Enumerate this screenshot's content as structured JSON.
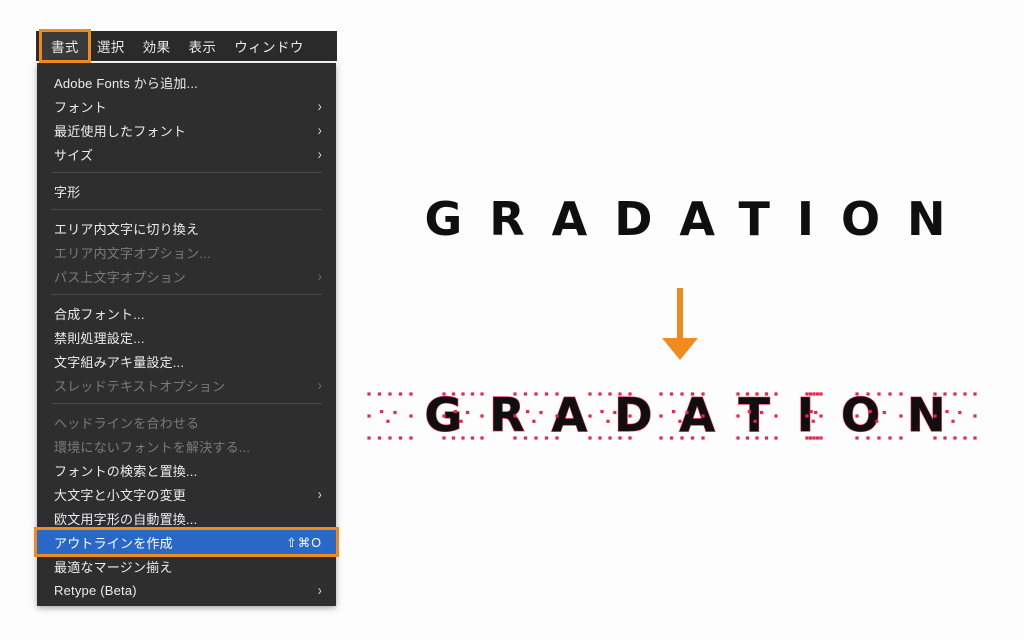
{
  "app": {
    "menubar": {
      "items": [
        {
          "label": "書式",
          "active": true
        },
        {
          "label": "選択",
          "active": false
        },
        {
          "label": "効果",
          "active": false
        },
        {
          "label": "表示",
          "active": false
        },
        {
          "label": "ウィンドウ",
          "active": false
        }
      ]
    },
    "dropdown": {
      "items": [
        {
          "label": "Adobe Fonts から追加...",
          "type": "item",
          "state": "enabled",
          "submenu": false,
          "shortcut": ""
        },
        {
          "label": "フォント",
          "type": "item",
          "state": "enabled",
          "submenu": true,
          "shortcut": ""
        },
        {
          "label": "最近使用したフォント",
          "type": "item",
          "state": "enabled",
          "submenu": true,
          "shortcut": ""
        },
        {
          "label": "サイズ",
          "type": "item",
          "state": "enabled",
          "submenu": true,
          "shortcut": ""
        },
        {
          "label": "",
          "type": "separator",
          "state": "",
          "submenu": false,
          "shortcut": ""
        },
        {
          "label": "字形",
          "type": "item",
          "state": "enabled",
          "submenu": false,
          "shortcut": ""
        },
        {
          "label": "",
          "type": "separator",
          "state": "",
          "submenu": false,
          "shortcut": ""
        },
        {
          "label": "エリア内文字に切り換え",
          "type": "item",
          "state": "enabled",
          "submenu": false,
          "shortcut": ""
        },
        {
          "label": "エリア内文字オプション...",
          "type": "item",
          "state": "disabled",
          "submenu": false,
          "shortcut": ""
        },
        {
          "label": "パス上文字オプション",
          "type": "item",
          "state": "disabled",
          "submenu": true,
          "shortcut": ""
        },
        {
          "label": "",
          "type": "separator",
          "state": "",
          "submenu": false,
          "shortcut": ""
        },
        {
          "label": "合成フォント...",
          "type": "item",
          "state": "enabled",
          "submenu": false,
          "shortcut": ""
        },
        {
          "label": "禁則処理設定...",
          "type": "item",
          "state": "enabled",
          "submenu": false,
          "shortcut": ""
        },
        {
          "label": "文字組みアキ量設定...",
          "type": "item",
          "state": "enabled",
          "submenu": false,
          "shortcut": ""
        },
        {
          "label": "スレッドテキストオプション",
          "type": "item",
          "state": "disabled",
          "submenu": true,
          "shortcut": ""
        },
        {
          "label": "",
          "type": "separator",
          "state": "",
          "submenu": false,
          "shortcut": ""
        },
        {
          "label": "ヘッドラインを合わせる",
          "type": "item",
          "state": "disabled",
          "submenu": false,
          "shortcut": ""
        },
        {
          "label": "環境にないフォントを解決する...",
          "type": "item",
          "state": "disabled",
          "submenu": false,
          "shortcut": ""
        },
        {
          "label": "フォントの検索と置換...",
          "type": "item",
          "state": "enabled",
          "submenu": false,
          "shortcut": ""
        },
        {
          "label": "大文字と小文字の変更",
          "type": "item",
          "state": "enabled",
          "submenu": true,
          "shortcut": ""
        },
        {
          "label": "欧文用字形の自動置換...",
          "type": "item",
          "state": "enabled",
          "submenu": false,
          "shortcut": ""
        },
        {
          "label": "アウトラインを作成",
          "type": "item",
          "state": "selected",
          "submenu": false,
          "shortcut": "⇧⌘O"
        },
        {
          "label": "最適なマージン揃え",
          "type": "item",
          "state": "enabled",
          "submenu": false,
          "shortcut": ""
        },
        {
          "label": "Retype (Beta)",
          "type": "item",
          "state": "enabled",
          "submenu": true,
          "shortcut": ""
        }
      ]
    },
    "artwork": {
      "text_before": "GRADATION",
      "text_after": "GRADATION",
      "arrow": "down-arrow"
    },
    "colors": {
      "menubar_bg": "#2a2a2a",
      "menu_bg": "#2e2e2e",
      "menu_text": "#ececec",
      "menu_text_disabled": "#7a7a7a",
      "selection_blue": "#2a68c8",
      "highlight_orange": "#f08a1b",
      "arrow_orange": "#ef8b21",
      "canvas_bg": "#fdfdfd",
      "artwork_black": "#100f0f",
      "anchor_red": "#e8264a"
    }
  }
}
